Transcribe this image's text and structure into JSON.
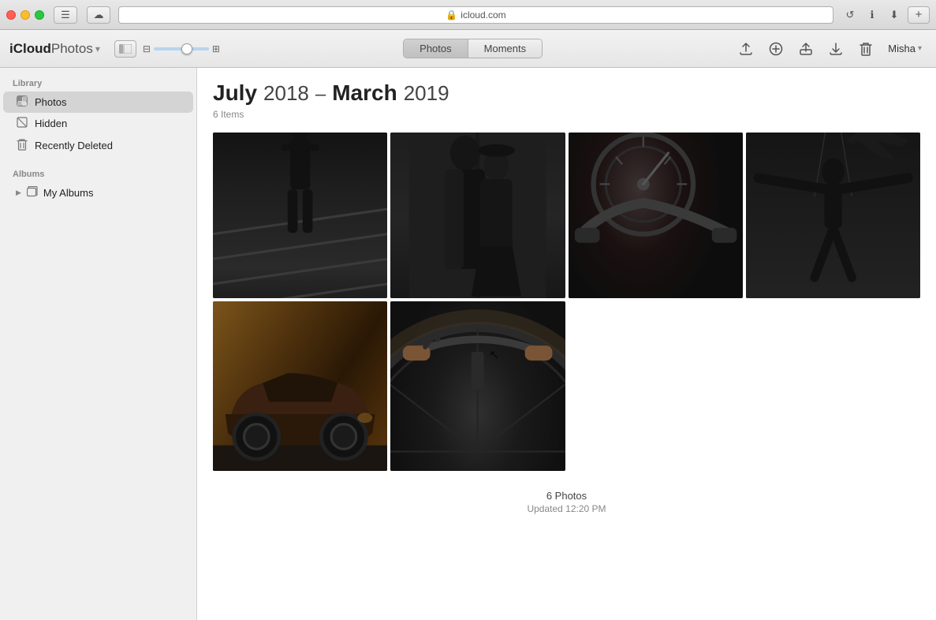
{
  "titlebar": {
    "address": "icloud.com",
    "lock_icon": "🔒",
    "reload_icon": "↺",
    "info_icon": "ℹ",
    "download_icon": "⬇",
    "add_tab_icon": "+"
  },
  "app_toolbar": {
    "app_name_bold": "iCloud",
    "app_name_light": " Photos",
    "app_dropdown": "▾",
    "sidebar_toggle_icon": "⊞",
    "zoom_min_icon": "⊟",
    "zoom_max_icon": "⊞",
    "tab_photos": "Photos",
    "tab_moments": "Moments",
    "upload_icon": "↑",
    "add_icon": "+",
    "share_icon": "↑",
    "download_icon": "↓",
    "trash_icon": "🗑",
    "user_name": "Misha",
    "user_dropdown": "▾"
  },
  "sidebar": {
    "library_label": "Library",
    "photos_item": "Photos",
    "hidden_item": "Hidden",
    "recently_deleted_item": "Recently Deleted",
    "albums_label": "Albums",
    "my_albums_item": "My Albums"
  },
  "content": {
    "title_bold": "July",
    "title_year1": "2018",
    "title_dash": "–",
    "title_bold2": "March",
    "title_year2": "2019",
    "item_count": "6 Items",
    "footer_count": "6 Photos",
    "footer_updated": "Updated 12:20 PM"
  },
  "photos": [
    {
      "id": "photo-1",
      "class": "p1",
      "alt": "Man on stairs black and white"
    },
    {
      "id": "photo-2",
      "class": "p2",
      "alt": "Couple portrait black and white"
    },
    {
      "id": "photo-3",
      "class": "p3",
      "alt": "Motorcycle closeup black and white"
    },
    {
      "id": "photo-4",
      "class": "p4",
      "alt": "Man jumping black and white"
    },
    {
      "id": "photo-5",
      "class": "p5",
      "alt": "Vintage car color"
    },
    {
      "id": "photo-6",
      "class": "p6",
      "alt": "Bicycle closeup black and white"
    }
  ]
}
